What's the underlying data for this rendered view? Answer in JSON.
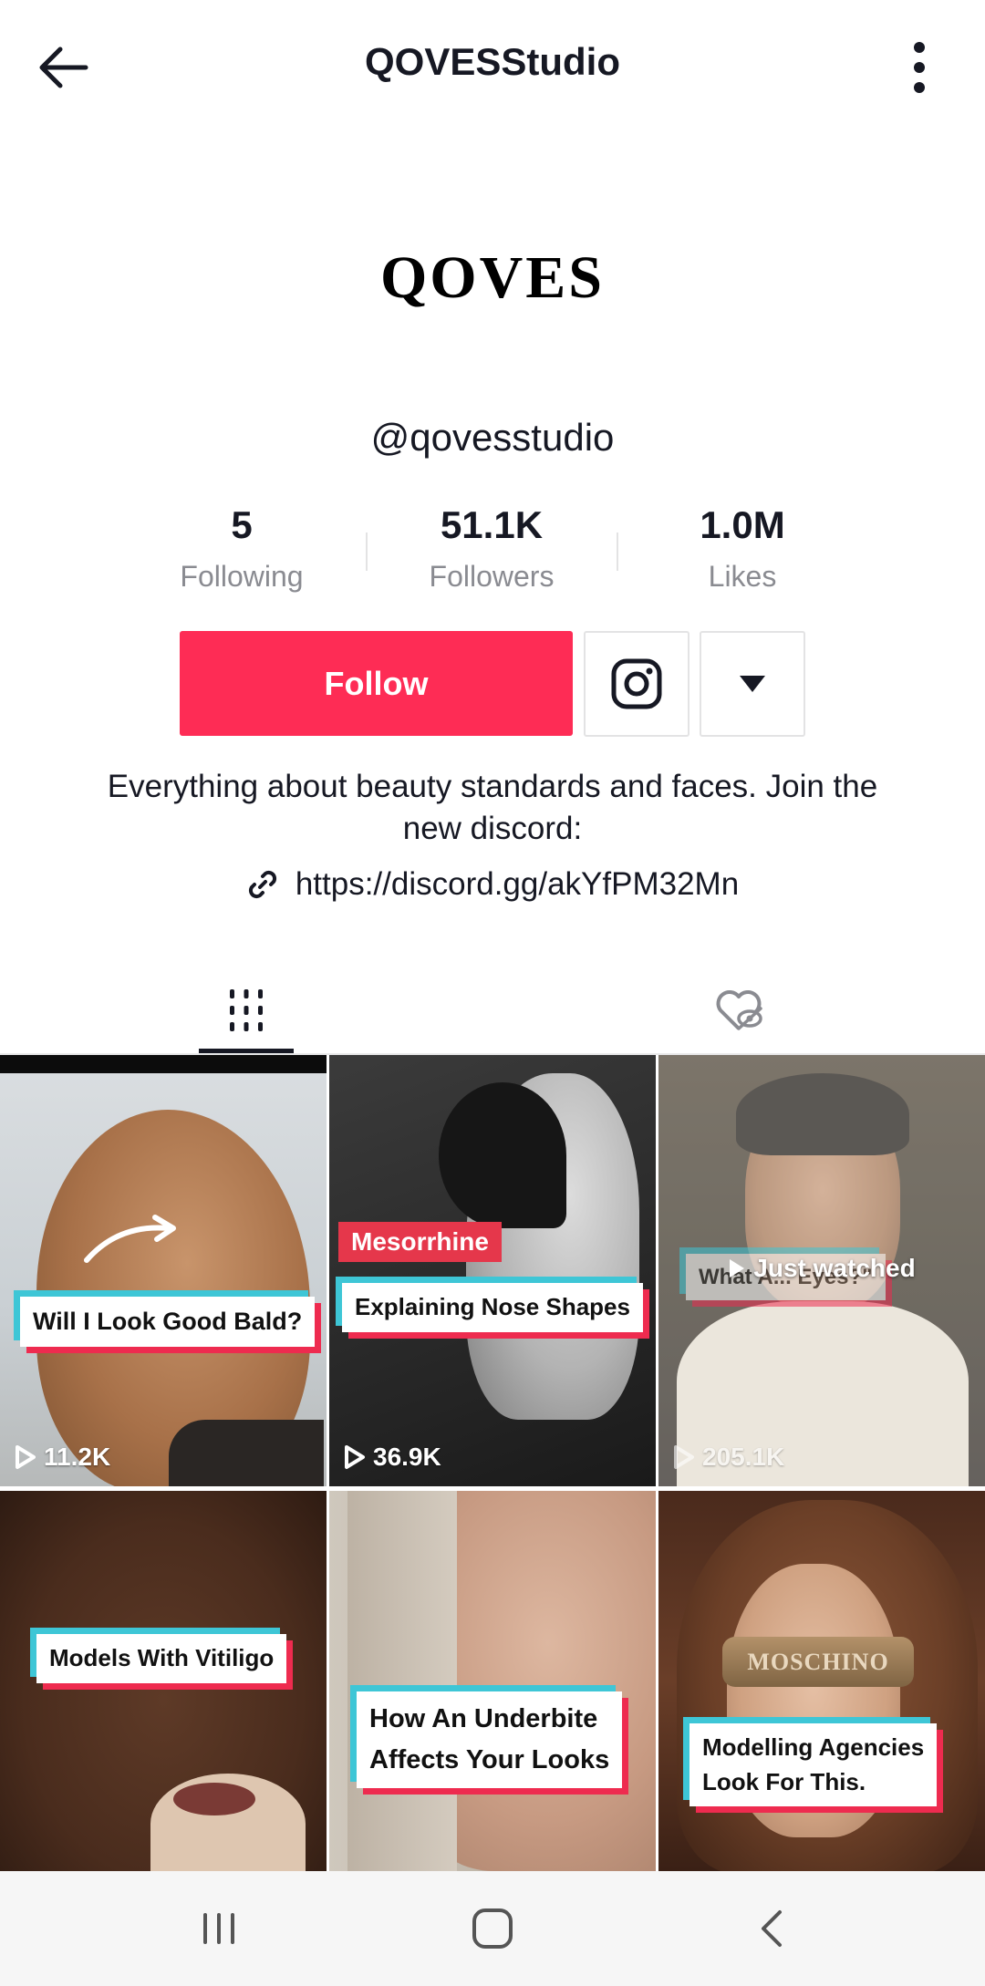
{
  "header": {
    "title": "QOVESStudio"
  },
  "profile": {
    "avatar_text": "QOVES",
    "username": "@qovesstudio",
    "stats": [
      {
        "value": "5",
        "label": "Following"
      },
      {
        "value": "51.1K",
        "label": "Followers"
      },
      {
        "value": "1.0M",
        "label": "Likes"
      }
    ],
    "follow_label": "Follow",
    "bio": "Everything about beauty standards and faces. Join the new discord:",
    "link": "https://discord.gg/akYfPM32Mn"
  },
  "tabs": [
    {
      "name": "videos",
      "icon": "grid-icon",
      "active": true
    },
    {
      "name": "liked",
      "icon": "heart-hidden-icon",
      "active": false
    }
  ],
  "videos": [
    {
      "caption": "Will I Look Good Bald?",
      "views": "11.2K"
    },
    {
      "tag": "Mesorrhine",
      "caption": "Explaining Nose Shapes",
      "views": "36.9K"
    },
    {
      "overlay": "Just watched",
      "caption_hidden": "What A... Eyes?\"",
      "views": "205.1K"
    },
    {
      "caption": "Models With Vitiligo"
    },
    {
      "caption_line1": "How An Underbite",
      "caption_line2": "Affects Your Looks"
    },
    {
      "caption_line1": "Modelling Agencies",
      "caption_line2": "Look For This.",
      "logo_text": "MOSCHINO"
    }
  ],
  "colors": {
    "accent": "#fe2c55",
    "cyan": "#3ec6d6",
    "red": "#ee2b4f"
  }
}
